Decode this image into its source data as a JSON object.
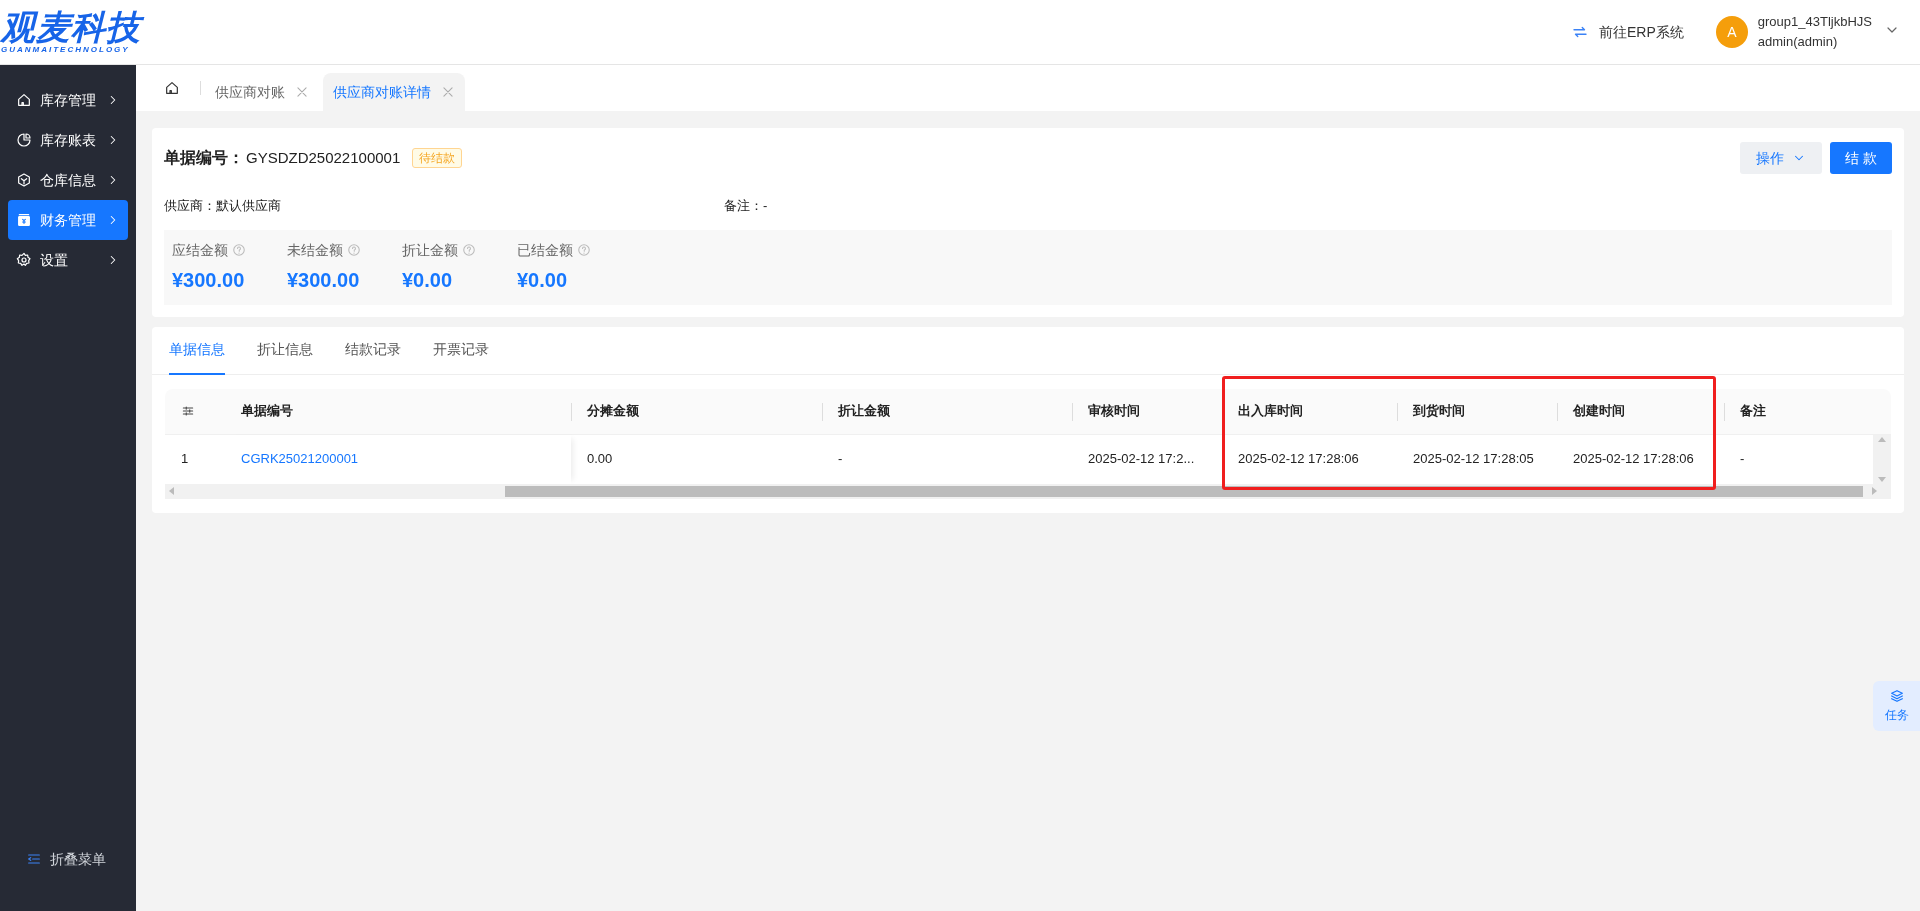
{
  "logo": {
    "title": "观麦科技",
    "subtitle": "GUANMAITECHNOLOGY"
  },
  "header": {
    "erp_link": "前往ERP系统",
    "avatar": "A",
    "user_group": "group1_43TljkbHJS",
    "user_name": "admin(admin)"
  },
  "sidebar": {
    "items": [
      {
        "label": "库存管理",
        "selected": false
      },
      {
        "label": "库存账表",
        "selected": false
      },
      {
        "label": "仓库信息",
        "selected": false
      },
      {
        "label": "财务管理",
        "selected": true
      },
      {
        "label": "设置",
        "selected": false
      }
    ],
    "collapse": "折叠菜单"
  },
  "page_tabs": [
    {
      "label": "供应商对账",
      "selected": false
    },
    {
      "label": "供应商对账详情",
      "selected": true
    }
  ],
  "document": {
    "number_label": "单据编号：",
    "number": "GYSDZD25022100001",
    "status": "待结款",
    "actions": [
      "操作",
      "结 款"
    ],
    "fields": [
      {
        "label": "供应商：",
        "value": "默认供应商"
      },
      {
        "label": "备注：",
        "value": "-"
      }
    ],
    "amounts": [
      {
        "label": "应结金额",
        "value": "¥300.00"
      },
      {
        "label": "未结金额",
        "value": "¥300.00"
      },
      {
        "label": "折让金额",
        "value": "¥0.00"
      },
      {
        "label": "已结金额",
        "value": "¥0.00"
      }
    ]
  },
  "detail_tabs": [
    {
      "label": "单据信息",
      "selected": true
    },
    {
      "label": "折让信息",
      "selected": false
    },
    {
      "label": "结款记录",
      "selected": false
    },
    {
      "label": "开票记录",
      "selected": false
    }
  ],
  "table": {
    "columns": [
      "",
      "单据编号",
      "分摊金额",
      "折让金额",
      "审核时间",
      "出入库时间",
      "到货时间",
      "创建时间",
      "备注"
    ],
    "rows": [
      [
        "1",
        "CGRK25021200001",
        "0.00",
        "-",
        "2025-02-12 17:2...",
        "2025-02-12 17:28:06",
        "2025-02-12 17:28:05",
        "2025-02-12 17:28:06",
        "-"
      ]
    ]
  },
  "task_button": "任务"
}
